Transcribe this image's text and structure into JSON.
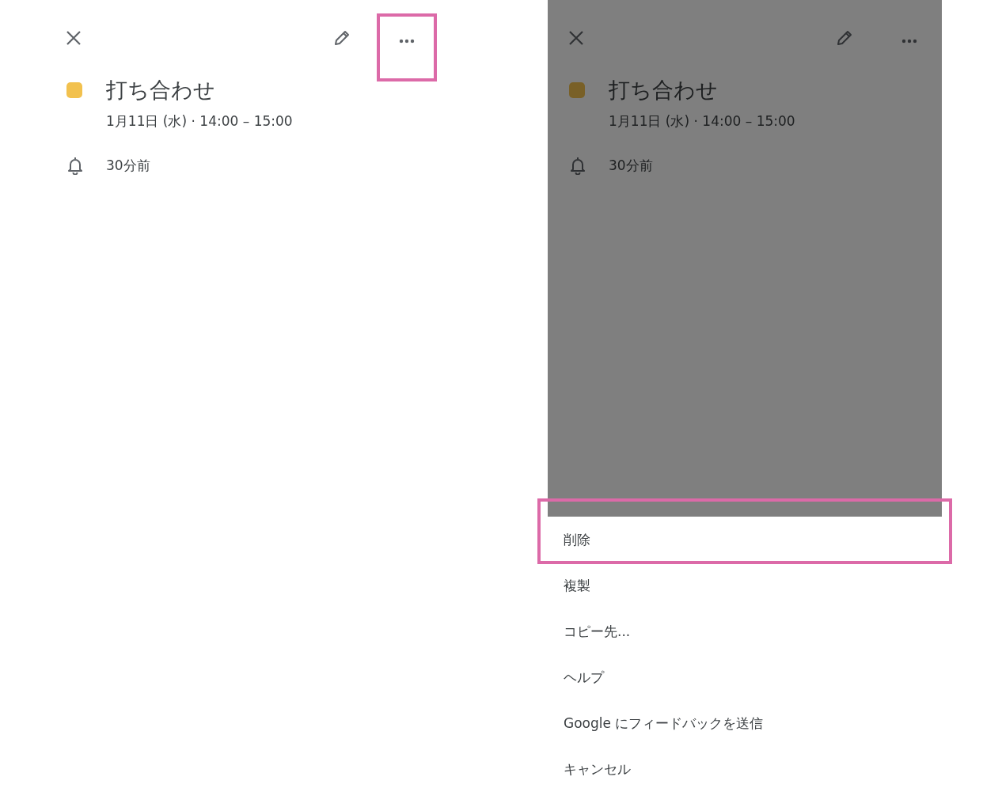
{
  "screens": [
    {
      "more_highlighted": true,
      "event": {
        "title": "打ち合わせ",
        "datetime": "1月11日 (水) · 14:00 – 15:00",
        "reminder": "30分前"
      }
    },
    {
      "more_highlighted": false,
      "event": {
        "title": "打ち合わせ",
        "datetime": "1月11日 (水) · 14:00 – 15:00",
        "reminder": "30分前"
      },
      "menu": [
        {
          "label": "削除",
          "highlighted": true
        },
        {
          "label": "複製",
          "highlighted": false
        },
        {
          "label": "コピー先...",
          "highlighted": false
        },
        {
          "label": "ヘルプ",
          "highlighted": false
        },
        {
          "label": "Google にフィードバックを送信",
          "highlighted": false
        },
        {
          "label": "キャンセル",
          "highlighted": false
        }
      ]
    }
  ]
}
